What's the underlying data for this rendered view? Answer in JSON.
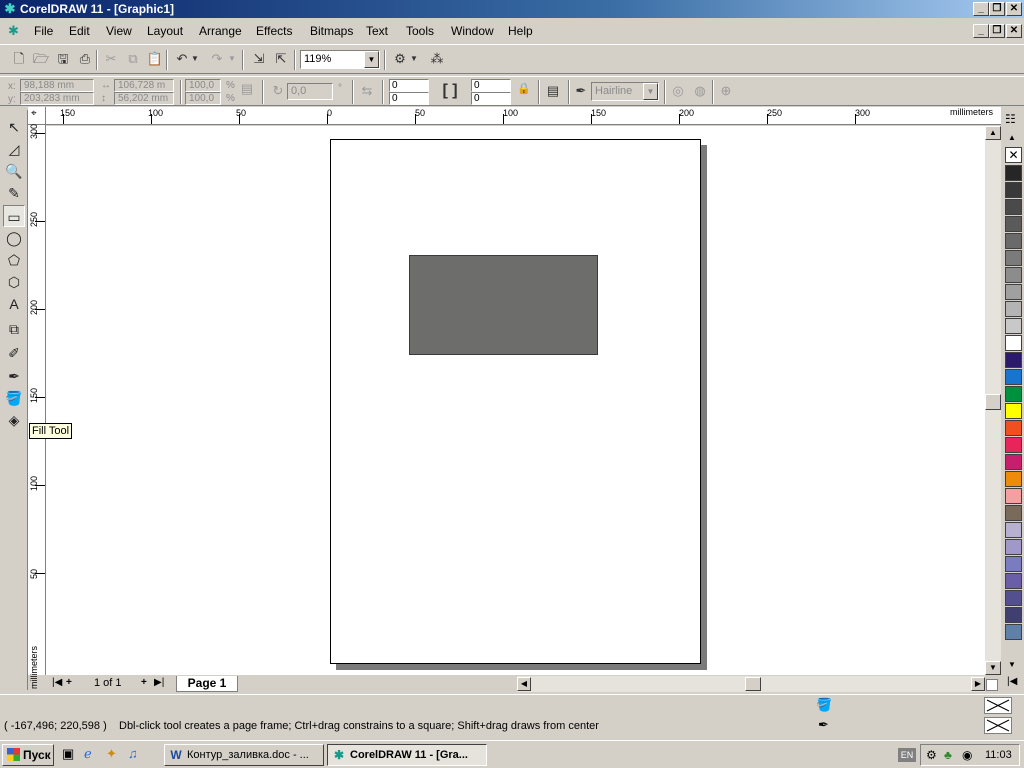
{
  "window": {
    "title": "CorelDRAW 11 - [Graphic1]",
    "min": "_",
    "max": "❐",
    "close": "✕"
  },
  "menu": {
    "items": [
      "File",
      "Edit",
      "View",
      "Layout",
      "Arrange",
      "Effects",
      "Bitmaps",
      "Text",
      "Tools",
      "Window",
      "Help"
    ]
  },
  "standard_toolbar": {
    "zoom": "119%"
  },
  "property_bar": {
    "x": "98,188 mm",
    "y": "203,283 mm",
    "w": "106,728 m",
    "h": "56,202 mm",
    "scale_w": "100,0",
    "scale_h": "100,0",
    "pct": "%",
    "rotation": "0,0",
    "deg": "°",
    "corner1": "0",
    "corner2": "0",
    "corner3": "0",
    "corner4": "0",
    "outline": "Hairline"
  },
  "rulers": {
    "unit": "millimeters",
    "h_labels": [
      "150",
      "100",
      "50",
      "0",
      "50",
      "100",
      "150",
      "200",
      "250",
      "300"
    ],
    "v_labels": [
      "300",
      "250",
      "200",
      "150",
      "100",
      "50"
    ]
  },
  "tooltip": "Fill Tool",
  "page_nav": {
    "count": "1 of 1",
    "tab": "Page 1"
  },
  "palette": {
    "colors": [
      "#262626",
      "#393939",
      "#4a4a4a",
      "#5a5a5a",
      "#6a6a6a",
      "#7b7b7b",
      "#8c8c8c",
      "#a0a0a0",
      "#b4b4b4",
      "#c8c8c8",
      "#ffffff",
      "#2b1a6b",
      "#1874cd",
      "#00913f",
      "#ffff00",
      "#f05020",
      "#e8245a",
      "#c81e6e",
      "#ee8b0a",
      "#f4a0a0",
      "#7a6a5a",
      "#b8b0d0",
      "#a098c8",
      "#7a7cc0",
      "#6a5ea8",
      "#545090",
      "#404070",
      "#6080a8"
    ]
  },
  "status": {
    "coords": "( -167,496; 220,598 )",
    "hint": "Dbl-click tool creates a page frame; Ctrl+drag constrains to a square; Shift+drag draws from center"
  },
  "taskbar": {
    "start": "Пуск",
    "task1": "Контур_заливка.doc - ...",
    "task2": "CorelDRAW 11 - [Gra...",
    "lang": "EN",
    "time": "11:03"
  }
}
